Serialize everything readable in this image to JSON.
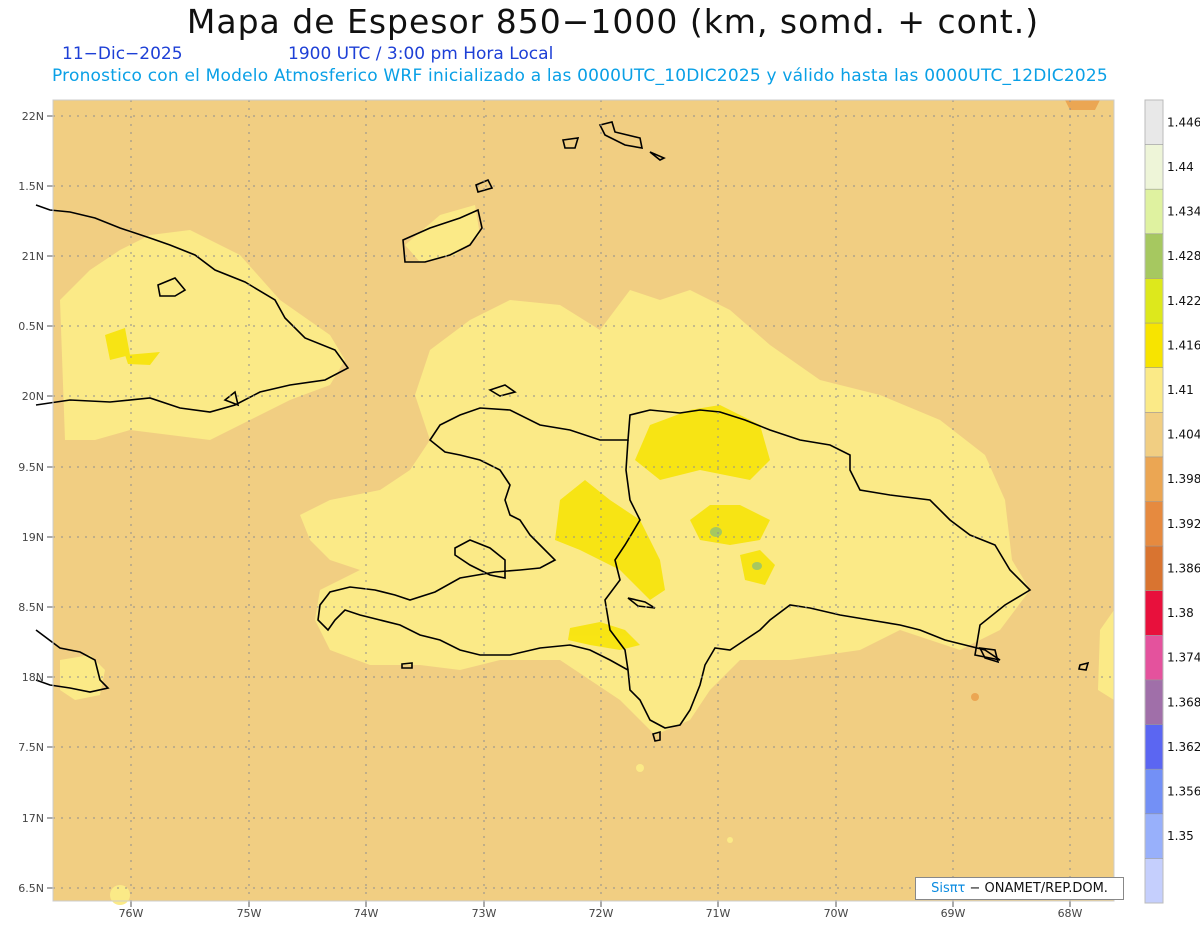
{
  "title": "Mapa de Espesor 850−1000 (km, somd. + cont.)",
  "date": "11−Dic−2025",
  "time": "1900 UTC / 3:00 pm Hora Local",
  "description": "Pronostico con el Modelo Atmosferico WRF inicializado a las 0000UTC_10DIC2025 y válido hasta las  0000UTC_12DIC2025",
  "credit": {
    "brand": "Sisπτ",
    "rest": " − ONAMET/REP.DOM."
  },
  "lat_labels": [
    "22N",
    "1.5N",
    "21N",
    "0.5N",
    "20N",
    "9.5N",
    "19N",
    "8.5N",
    "18N",
    "7.5N",
    "17N",
    "6.5N"
  ],
  "lon_labels": [
    "76W",
    "75W",
    "74W",
    "73W",
    "72W",
    "71W",
    "70W",
    "69W",
    "68W"
  ],
  "colorbar": {
    "labels": [
      "1.446",
      "1.44",
      "1.434",
      "1.428",
      "1.422",
      "1.416",
      "1.41",
      "1.404",
      "1.398",
      "1.392",
      "1.386",
      "1.38",
      "1.374",
      "1.368",
      "1.362",
      "1.356",
      "1.35"
    ],
    "colors": [
      "#e8e8e8",
      "#eef5d8",
      "#dff2a0",
      "#a6c860",
      "#dde81c",
      "#f7e400",
      "#fbea87",
      "#f1ce82",
      "#eba653",
      "#e68a3f",
      "#d97430",
      "#e8103c",
      "#e4529d",
      "#a06fa9",
      "#5b66f2",
      "#7390f6",
      "#98b0fb",
      "#c5cffd"
    ]
  },
  "colors": {
    "background_fill": "#f1ce82",
    "level_1_41": "#fbea87",
    "level_1_416": "#f7e400",
    "coast": "#000000",
    "title_blue": "#1d3fd6",
    "desc_blue": "#0aa0e6"
  }
}
